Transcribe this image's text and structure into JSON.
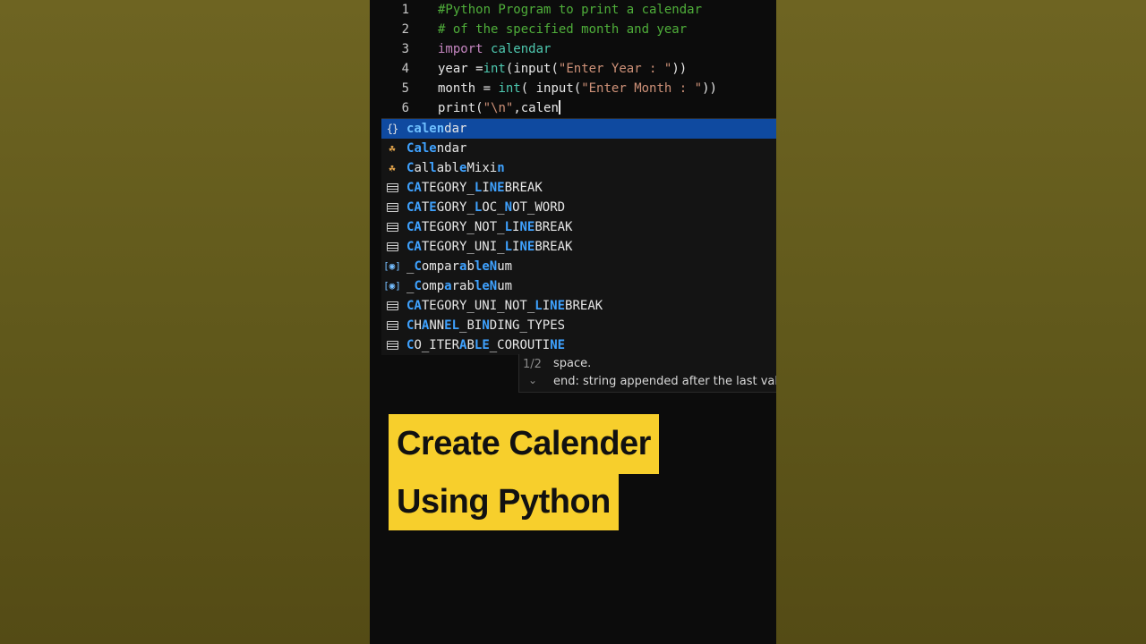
{
  "editor": {
    "lines": [
      {
        "num": "1",
        "tokens": [
          {
            "t": "#Python Program to print a calendar",
            "c": "cm"
          }
        ]
      },
      {
        "num": "2",
        "tokens": [
          {
            "t": "# of the specified month and year",
            "c": "cm"
          }
        ]
      },
      {
        "num": "3",
        "tokens": [
          {
            "t": "import",
            "c": "kw"
          },
          {
            "t": " ",
            "c": "tx"
          },
          {
            "t": "calendar",
            "c": "bi"
          }
        ]
      },
      {
        "num": "4",
        "tokens": [
          {
            "t": "year",
            "c": "tx"
          },
          {
            "t": " =",
            "c": "tx"
          },
          {
            "t": "int",
            "c": "bi"
          },
          {
            "t": "(",
            "c": "tx"
          },
          {
            "t": "input",
            "c": "tx"
          },
          {
            "t": "(",
            "c": "tx"
          },
          {
            "t": "\"Enter Year : \"",
            "c": "str"
          },
          {
            "t": "))",
            "c": "tx"
          }
        ]
      },
      {
        "num": "5",
        "tokens": [
          {
            "t": "month",
            "c": "tx"
          },
          {
            "t": " = ",
            "c": "tx"
          },
          {
            "t": "int",
            "c": "bi"
          },
          {
            "t": "( ",
            "c": "tx"
          },
          {
            "t": "input",
            "c": "tx"
          },
          {
            "t": "(",
            "c": "tx"
          },
          {
            "t": "\"Enter Month : \"",
            "c": "str"
          },
          {
            "t": "))",
            "c": "tx"
          }
        ]
      },
      {
        "num": "6",
        "tokens": [
          {
            "t": "print",
            "c": "tx"
          },
          {
            "t": "(",
            "c": "tx"
          },
          {
            "t": "\"\\n\"",
            "c": "str"
          },
          {
            "t": ",calen",
            "c": "tx"
          }
        ],
        "cursor": true
      }
    ]
  },
  "suggestions": {
    "selected_index": 0,
    "items": [
      {
        "icon": "module-icon",
        "parts": [
          [
            "cal",
            1
          ],
          [
            "en",
            1
          ],
          [
            "dar",
            0
          ]
        ]
      },
      {
        "icon": "class-icon",
        "parts": [
          [
            "C",
            1
          ],
          [
            "al",
            1
          ],
          [
            "e",
            1
          ],
          [
            "nd",
            0
          ],
          [
            "ar",
            0
          ]
        ]
      },
      {
        "icon": "class-icon",
        "parts": [
          [
            "C",
            1
          ],
          [
            "al",
            0
          ],
          [
            "l",
            1
          ],
          [
            "abl",
            0
          ],
          [
            "e",
            1
          ],
          [
            "Mixi",
            0
          ],
          [
            "n",
            1
          ]
        ]
      },
      {
        "icon": "constant-icon",
        "parts": [
          [
            "CA",
            1
          ],
          [
            "TEGORY_",
            0
          ],
          [
            "L",
            1
          ],
          [
            "I",
            0
          ],
          [
            "NE",
            1
          ],
          [
            "BREAK",
            0
          ]
        ]
      },
      {
        "icon": "constant-icon",
        "parts": [
          [
            "CA",
            1
          ],
          [
            "T",
            0
          ],
          [
            "E",
            1
          ],
          [
            "GORY_",
            0
          ],
          [
            "L",
            1
          ],
          [
            "OC_",
            0
          ],
          [
            "N",
            1
          ],
          [
            "OT_WORD",
            0
          ]
        ]
      },
      {
        "icon": "constant-icon",
        "parts": [
          [
            "CA",
            1
          ],
          [
            "TEGORY_NOT_",
            0
          ],
          [
            "L",
            1
          ],
          [
            "I",
            0
          ],
          [
            "NE",
            1
          ],
          [
            "BREAK",
            0
          ]
        ]
      },
      {
        "icon": "constant-icon",
        "parts": [
          [
            "CA",
            1
          ],
          [
            "TEGORY_UNI_",
            0
          ],
          [
            "L",
            1
          ],
          [
            "I",
            0
          ],
          [
            "NE",
            1
          ],
          [
            "BREAK",
            0
          ]
        ]
      },
      {
        "icon": "field-icon",
        "parts": [
          [
            "_",
            0
          ],
          [
            "C",
            1
          ],
          [
            "ompar",
            0
          ],
          [
            "a",
            1
          ],
          [
            "b",
            0
          ],
          [
            "l",
            1
          ],
          [
            "e",
            1
          ],
          [
            "N",
            1
          ],
          [
            "um",
            0
          ]
        ]
      },
      {
        "icon": "field-icon",
        "parts": [
          [
            "_",
            0
          ],
          [
            "C",
            1
          ],
          [
            "omp",
            0
          ],
          [
            "a",
            1
          ],
          [
            "rab",
            0
          ],
          [
            "l",
            1
          ],
          [
            "e",
            1
          ],
          [
            "N",
            1
          ],
          [
            "um",
            0
          ]
        ]
      },
      {
        "icon": "constant-icon",
        "parts": [
          [
            "CA",
            1
          ],
          [
            "TEGORY_UNI_NOT_",
            0
          ],
          [
            "L",
            1
          ],
          [
            "I",
            0
          ],
          [
            "NE",
            1
          ],
          [
            "BREAK",
            0
          ]
        ]
      },
      {
        "icon": "constant-icon",
        "parts": [
          [
            "C",
            1
          ],
          [
            "H",
            0
          ],
          [
            "A",
            1
          ],
          [
            "NN",
            0
          ],
          [
            "EL",
            1
          ],
          [
            "_BI",
            0
          ],
          [
            "N",
            1
          ],
          [
            "DING_TYPES",
            0
          ]
        ]
      },
      {
        "icon": "constant-icon",
        "parts": [
          [
            "C",
            1
          ],
          [
            "O_ITER",
            0
          ],
          [
            "A",
            1
          ],
          [
            "B",
            0
          ],
          [
            "LE",
            1
          ],
          [
            "_COROUTI",
            0
          ],
          [
            "NE",
            1
          ]
        ]
      }
    ]
  },
  "detail": {
    "counter": "1/2",
    "line1": "space.",
    "line2": "end: string appended after the last val"
  },
  "caption": {
    "line1": "Create Calender",
    "line2": "Using Python"
  }
}
